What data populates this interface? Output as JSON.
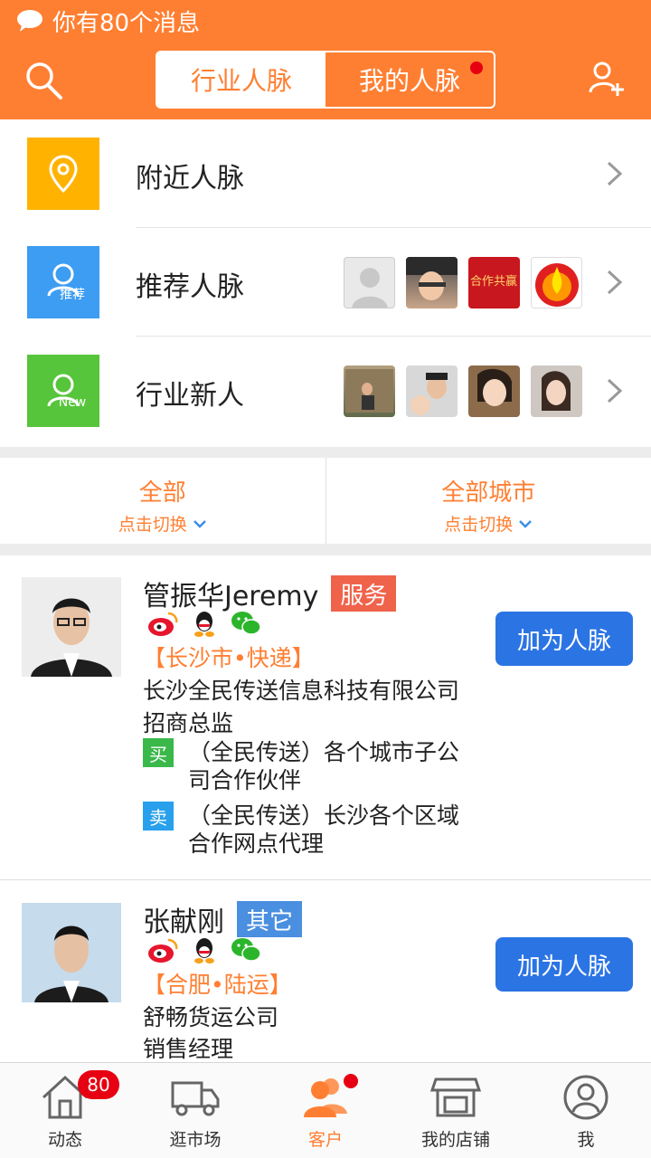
{
  "notice": {
    "text": "你有80个消息"
  },
  "tabs": [
    {
      "label": "行业人脉",
      "active": true
    },
    {
      "label": "我的人脉",
      "active": false,
      "has_dot": true
    }
  ],
  "quick_links": [
    {
      "label": "附近人脉",
      "tile_color": "#ffb300",
      "icon": "location-pin-icon"
    },
    {
      "label": "推荐人脉",
      "tile_color": "#3d9df2",
      "icon": "user-icon",
      "tile_text": "推荐"
    },
    {
      "label": "行业新人",
      "tile_color": "#57c53b",
      "icon": "user-icon",
      "tile_text": "New"
    }
  ],
  "recommend_thumbs_text": "合作共赢",
  "filters": [
    {
      "label": "全部",
      "hint": "点击切换"
    },
    {
      "label": "全部城市",
      "hint": "点击切换"
    }
  ],
  "contacts": [
    {
      "name": "管振华Jeremy",
      "tag": "服务",
      "tag_color": "#f0634b",
      "city": "【长沙市•快递】",
      "company": "长沙全民传送信息科技有限公司",
      "title": "招商总监",
      "deals": [
        {
          "badge": "买",
          "badge_color": "#3bb84a",
          "text": "（全民传送）各个城市子公司合作伙伴"
        },
        {
          "badge": "卖",
          "badge_color": "#28a0ec",
          "text": "（全民传送）长沙各个区域合作网点代理"
        }
      ],
      "button": "加为人脉"
    },
    {
      "name": "张献刚",
      "tag": "其它",
      "tag_color": "#4a8fe0",
      "city": "【合肥•陆运】",
      "company": "舒畅货运公司",
      "title": "销售经理",
      "button": "加为人脉"
    }
  ],
  "nav": [
    {
      "label": "动态",
      "icon": "home-icon",
      "badge": "80"
    },
    {
      "label": "逛市场",
      "icon": "truck-icon"
    },
    {
      "label": "客户",
      "icon": "contacts-icon",
      "active": true,
      "has_dot": true
    },
    {
      "label": "我的店铺",
      "icon": "shop-icon"
    },
    {
      "label": "我",
      "icon": "profile-icon"
    }
  ],
  "colors": {
    "brand": "#ff7f32",
    "button_blue": "#2b74e4",
    "badge_red": "#e60012"
  }
}
